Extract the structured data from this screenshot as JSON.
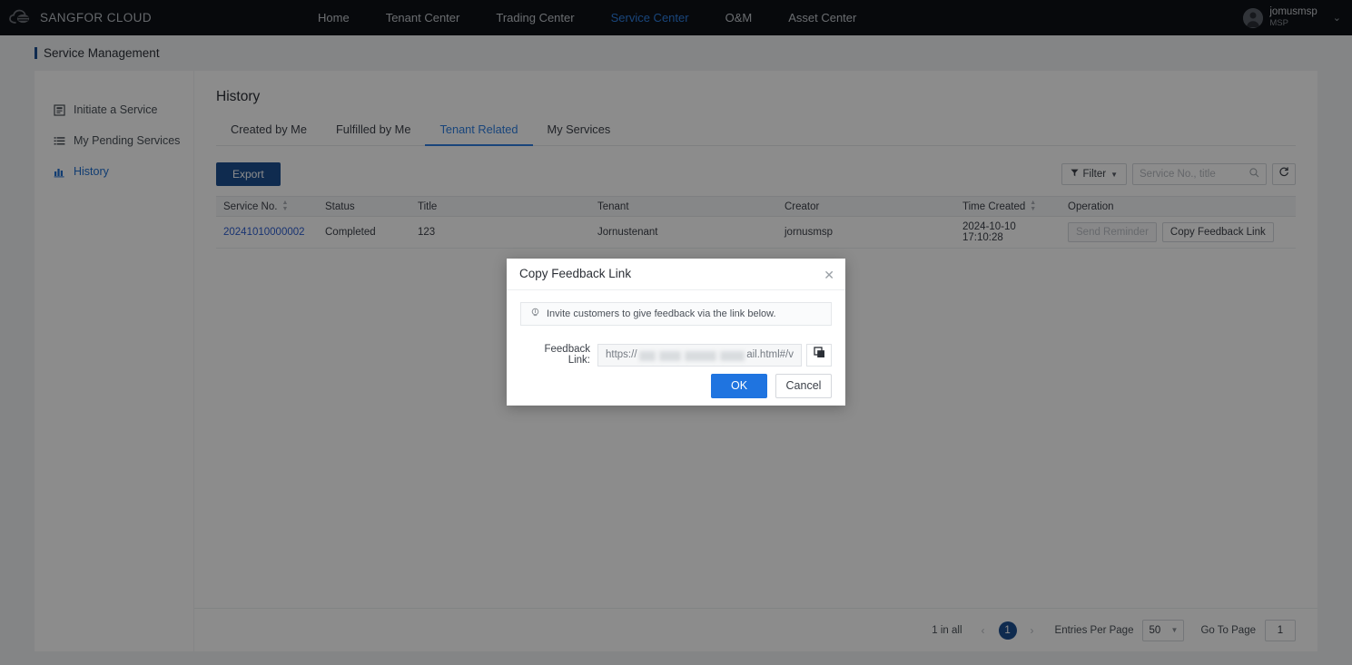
{
  "topnav": {
    "brand": "SANGFOR CLOUD",
    "items": [
      {
        "label": "Home",
        "active": false
      },
      {
        "label": "Tenant Center",
        "active": false
      },
      {
        "label": "Trading Center",
        "active": false
      },
      {
        "label": "Service Center",
        "active": true
      },
      {
        "label": "O&M",
        "active": false
      },
      {
        "label": "Asset Center",
        "active": false
      }
    ],
    "user": {
      "name": "jomusmsp",
      "role": "MSP"
    },
    "accent": "#2f7fe0"
  },
  "page": {
    "header": "Service Management"
  },
  "sidebar": {
    "items": [
      {
        "label": "Initiate a Service",
        "icon": "form-icon",
        "active": false
      },
      {
        "label": "My Pending Services",
        "icon": "list-icon",
        "active": false
      },
      {
        "label": "History",
        "icon": "bar-chart-icon",
        "active": true
      }
    ]
  },
  "main": {
    "title": "History",
    "tabs": [
      {
        "label": "Created by Me",
        "active": false
      },
      {
        "label": "Fulfilled by Me",
        "active": false
      },
      {
        "label": "Tenant Related",
        "active": true
      },
      {
        "label": "My Services",
        "active": false
      }
    ],
    "toolbar": {
      "export_label": "Export",
      "filter_label": "Filter",
      "search_placeholder": "Service No., title",
      "search_value": ""
    },
    "table": {
      "columns": [
        {
          "label": "Service No.",
          "sortable": true
        },
        {
          "label": "Status",
          "sortable": false
        },
        {
          "label": "Title",
          "sortable": false
        },
        {
          "label": "Tenant",
          "sortable": false
        },
        {
          "label": "Creator",
          "sortable": false
        },
        {
          "label": "Time Created",
          "sortable": true
        },
        {
          "label": "Operation",
          "sortable": false
        }
      ],
      "rows": [
        {
          "service_no": "20241010000002",
          "status": "Completed",
          "title": "123",
          "tenant": "Jornustenant",
          "creator": "jornusmsp",
          "time_created": "2024-10-10 17:10:28",
          "ops": [
            {
              "label": "Send Reminder",
              "disabled": true
            },
            {
              "label": "Copy Feedback Link",
              "disabled": false
            }
          ]
        }
      ]
    },
    "pagination": {
      "total_text": "1 in all",
      "current_page": "1",
      "entries_label": "Entries Per Page",
      "entries_value": "50",
      "goto_label": "Go To Page",
      "goto_value": "1"
    }
  },
  "modal": {
    "title": "Copy Feedback Link",
    "tip": "Invite customers to give feedback via the link below.",
    "link_label": "Feedback Link:",
    "link_prefix": "https://",
    "link_suffix": "ail.html#/v",
    "ok_label": "OK",
    "cancel_label": "Cancel",
    "ok_color": "#1f74e0"
  }
}
